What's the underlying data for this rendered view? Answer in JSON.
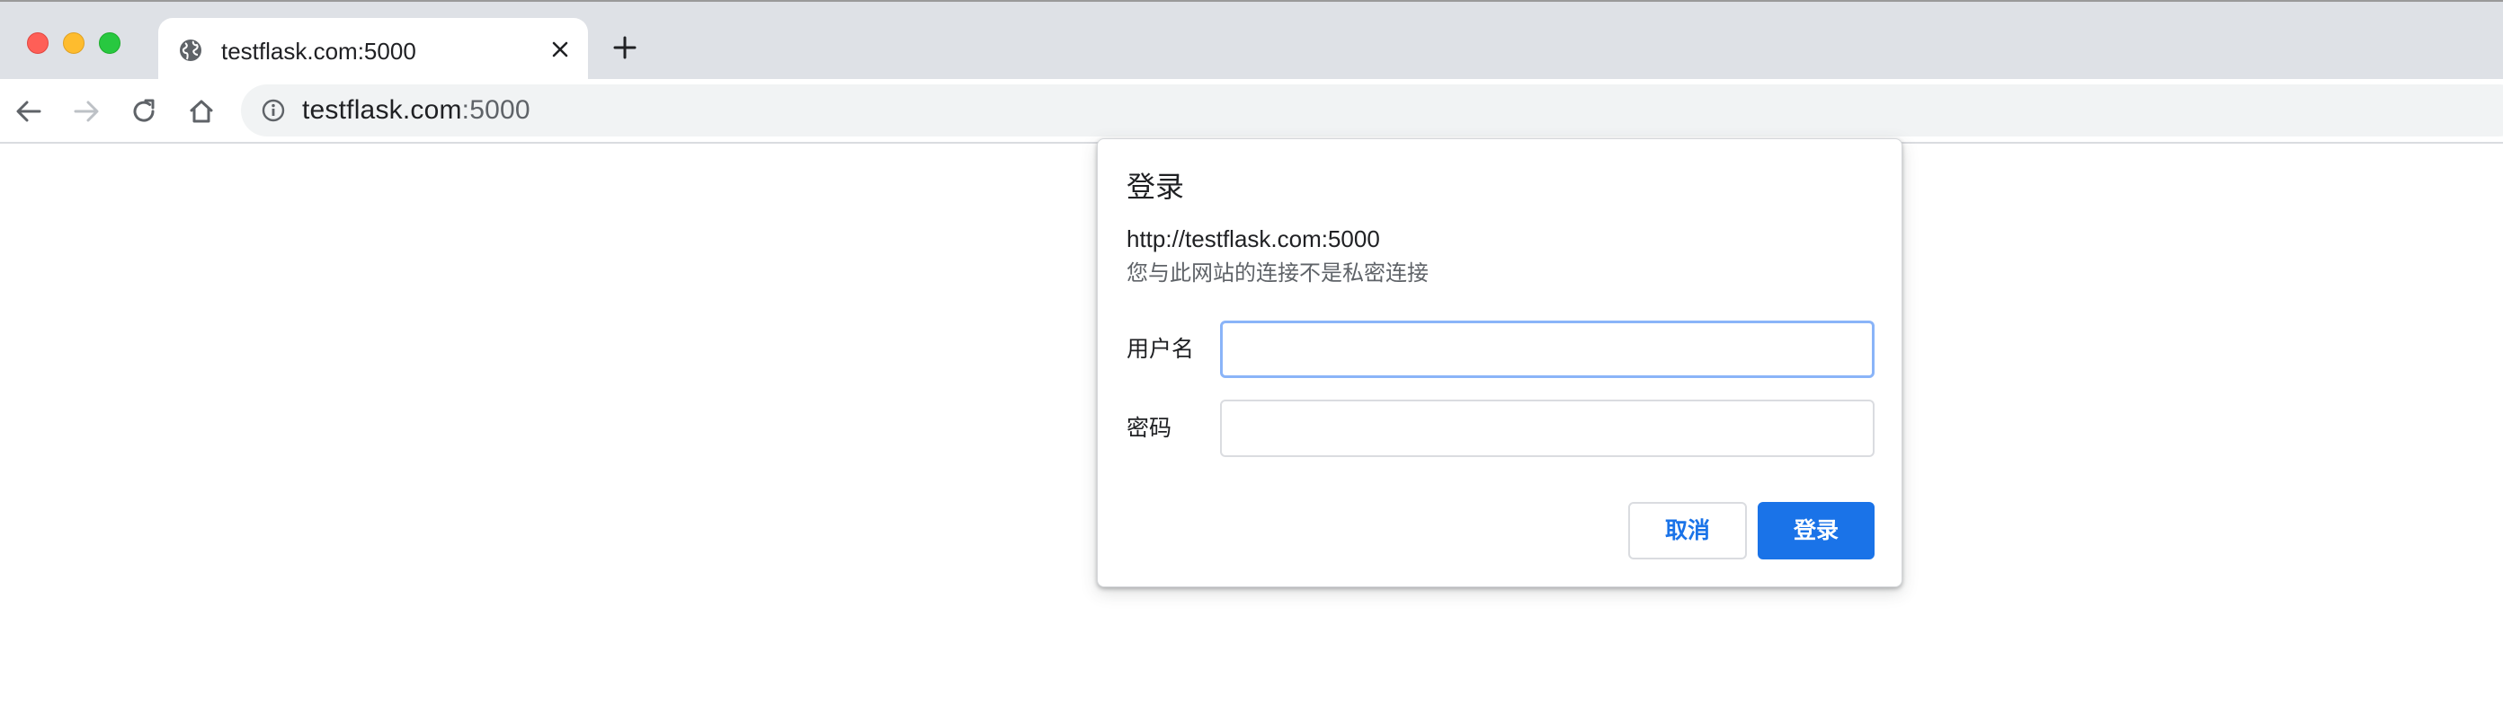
{
  "browser": {
    "window_controls": {
      "close_color": "#fe5f57",
      "minimize_color": "#febc2e",
      "maximize_color": "#28c840"
    },
    "tab": {
      "title": "testflask.com:5000",
      "favicon": "globe-icon",
      "close_icon": "close-icon"
    },
    "new_tab_icon": "plus-icon",
    "toolbar": {
      "back_icon": "arrow-left-icon",
      "forward_icon": "arrow-right-icon",
      "reload_icon": "reload-icon",
      "home_icon": "home-icon"
    },
    "omnibox": {
      "info_icon": "info-icon",
      "host": "testflask.com",
      "port": ":5000"
    }
  },
  "auth_dialog": {
    "title": "登录",
    "origin": "http://testflask.com:5000",
    "warning": "您与此网站的连接不是私密连接",
    "username_label": "用户名",
    "username_value": "",
    "password_label": "密码",
    "password_value": "",
    "cancel_label": "取消",
    "login_label": "登录",
    "accent_color": "#1a73e8"
  }
}
